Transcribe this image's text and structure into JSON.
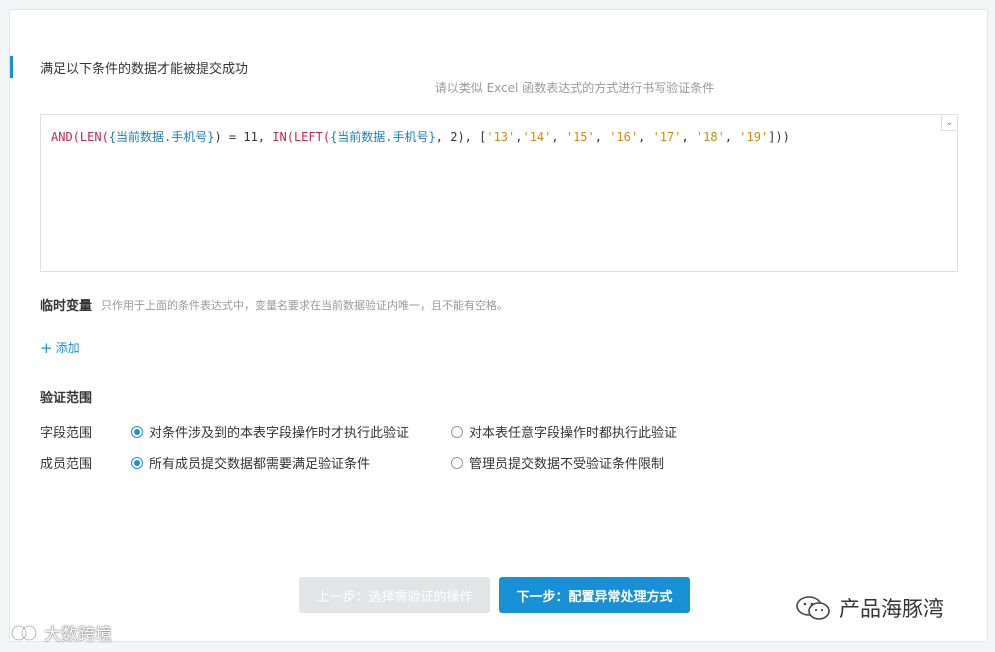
{
  "section": {
    "title": "满足以下条件的数据才能被提交成功",
    "hint": "请以类似 Excel 函数表达式的方式进行书写验证条件"
  },
  "editor": {
    "tokens": [
      {
        "t": "AND(LEN(",
        "c": "fn"
      },
      {
        "t": "{当前数据.手机号}",
        "c": "fld"
      },
      {
        "t": ") = 11, ",
        "c": "op"
      },
      {
        "t": "IN(LEFT(",
        "c": "fn"
      },
      {
        "t": "{当前数据.手机号}",
        "c": "fld"
      },
      {
        "t": ", 2), [",
        "c": "op"
      },
      {
        "t": "'13'",
        "c": "str"
      },
      {
        "t": ",",
        "c": "op"
      },
      {
        "t": "'14'",
        "c": "str"
      },
      {
        "t": ", ",
        "c": "op"
      },
      {
        "t": "'15'",
        "c": "str"
      },
      {
        "t": ", ",
        "c": "op"
      },
      {
        "t": "'16'",
        "c": "str"
      },
      {
        "t": ", ",
        "c": "op"
      },
      {
        "t": "'17'",
        "c": "str"
      },
      {
        "t": ", ",
        "c": "op"
      },
      {
        "t": "'18'",
        "c": "str"
      },
      {
        "t": ", ",
        "c": "op"
      },
      {
        "t": "'19'",
        "c": "str"
      },
      {
        "t": "]))",
        "c": "op"
      }
    ],
    "toggle_icon": "chevron-down-icon"
  },
  "temp_vars": {
    "label": "临时变量",
    "description": "只作用于上面的条件表达式中，变量名要求在当前数据验证内唯一，且不能有空格。",
    "add_label": "添加"
  },
  "scope": {
    "title": "验证范围",
    "field_label": "字段范围",
    "field_options": [
      {
        "label": "对条件涉及到的本表字段操作时才执行此验证",
        "checked": true
      },
      {
        "label": "对本表任意字段操作时都执行此验证",
        "checked": false
      }
    ],
    "member_label": "成员范围",
    "member_options": [
      {
        "label": "所有成员提交数据都需要满足验证条件",
        "checked": true
      },
      {
        "label": "管理员提交数据不受验证条件限制",
        "checked": false
      }
    ]
  },
  "buttons": {
    "prev": "上一步：选择需验证的操作",
    "next": "下一步：配置异常处理方式"
  },
  "watermarks": {
    "right": "产品海豚湾",
    "left": "大数跨境"
  },
  "colors": {
    "accent": "#1890d5",
    "function": "#c7254e",
    "field": "#1a7fb5",
    "string": "#d4890a"
  }
}
